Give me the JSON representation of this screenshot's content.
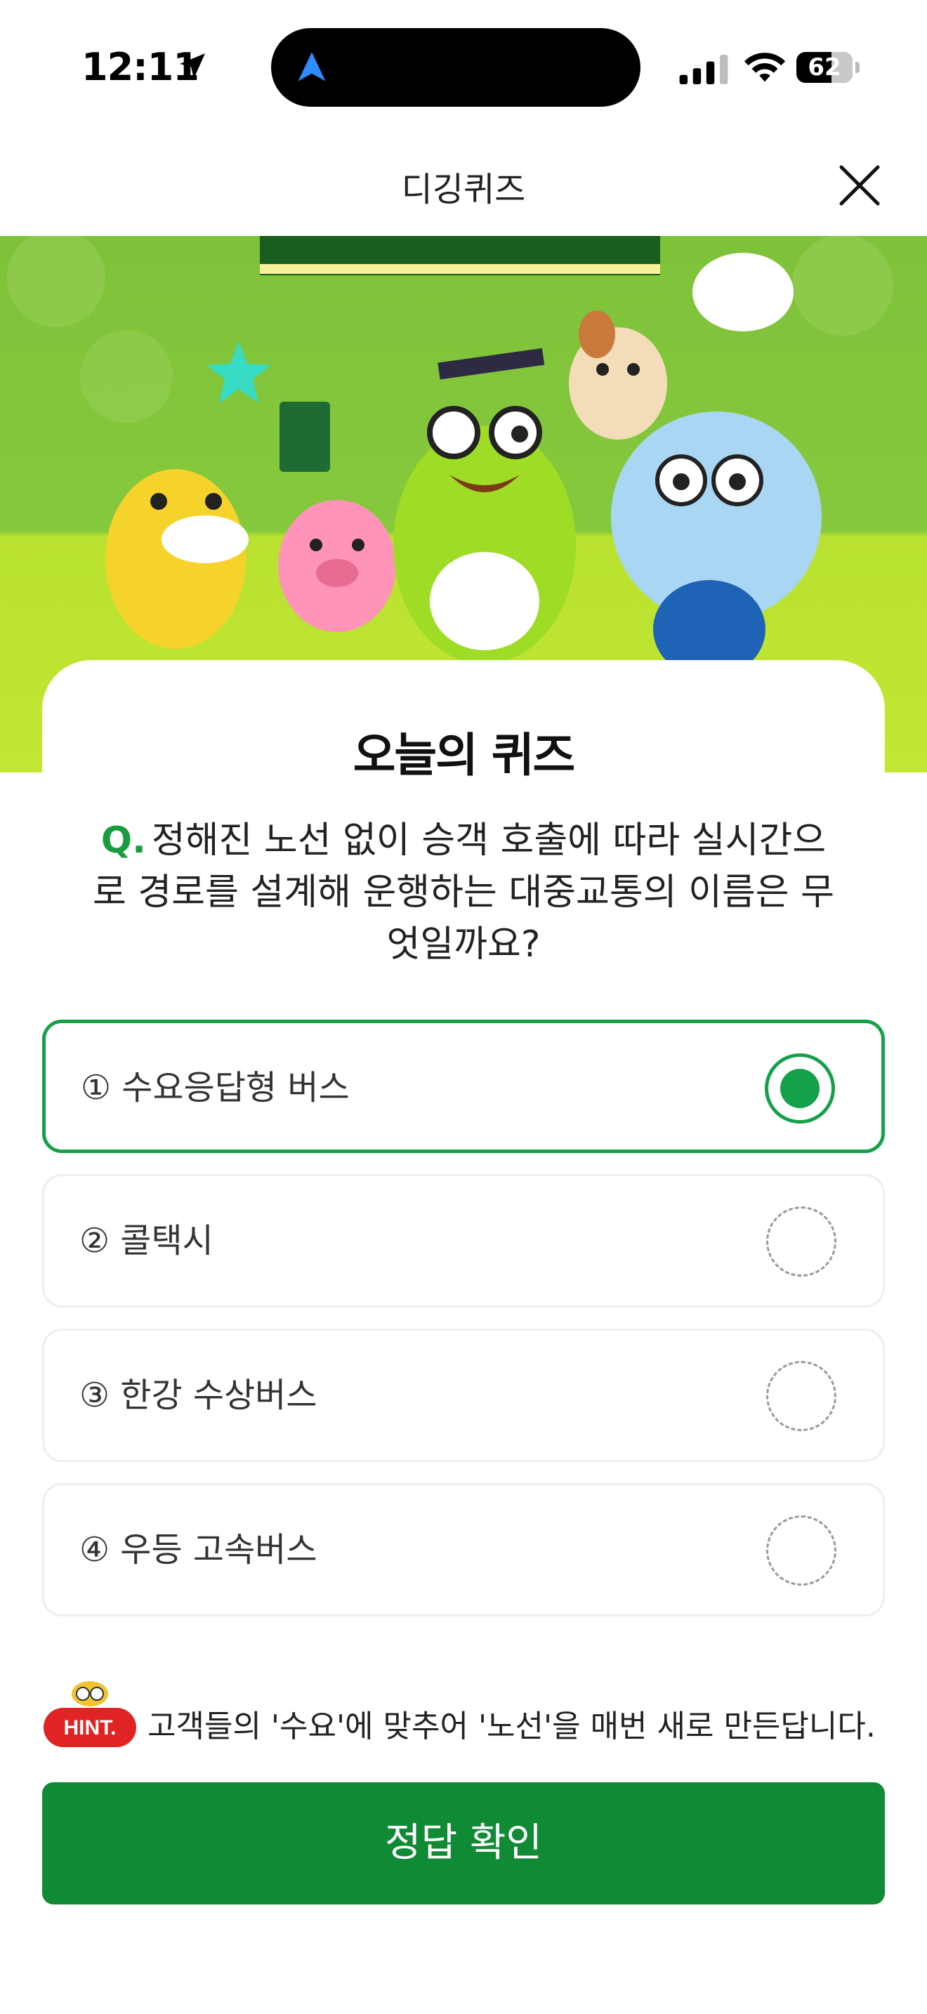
{
  "status_bar": {
    "time": "12:11",
    "battery": "62"
  },
  "header": {
    "title": "디깅퀴즈"
  },
  "quiz": {
    "title": "오늘의 퀴즈",
    "q_mark": "Q.",
    "question": "정해진 노선 없이 승객 호출에 따라 실시간으로 경로를 설계해 운행하는 대중교통의 이름은 무엇일까요?",
    "options": [
      {
        "label": "① 수요응답형 버스",
        "selected": true
      },
      {
        "label": "② 콜택시",
        "selected": false
      },
      {
        "label": "③ 한강 수상버스",
        "selected": false
      },
      {
        "label": "④ 우등 고속버스",
        "selected": false
      }
    ]
  },
  "hint": {
    "badge": "HINT.",
    "text": "고객들의 '수요'에 맞추어 '노선'을 매번 새로 만든답니다."
  },
  "confirm_button": {
    "label": "정답 확인"
  },
  "colors": {
    "accent": "#15a04a",
    "button": "#118a35",
    "hint_badge": "#e02424"
  }
}
